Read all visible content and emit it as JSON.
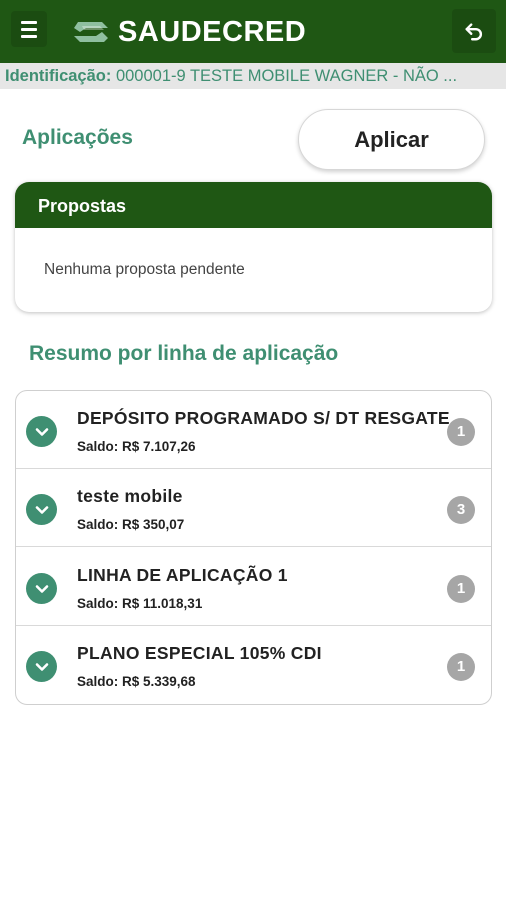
{
  "app": {
    "brand": "SAUDECRED"
  },
  "identification": {
    "label": "Identificação:",
    "value": "000001-9 TESTE MOBILE WAGNER - NÃO ..."
  },
  "applications": {
    "title": "Aplicações",
    "apply_button": "Aplicar"
  },
  "proposals": {
    "header": "Propostas",
    "empty_message": "Nenhuma proposta pendente"
  },
  "summary": {
    "title": "Resumo por linha de aplicação",
    "items": [
      {
        "title": "DEPÓSITO PROGRAMADO S/ DT RESGATE",
        "saldo": "Saldo: R$ 7.107,26",
        "count": "1"
      },
      {
        "title": "teste mobile",
        "saldo": "Saldo: R$ 350,07",
        "count": "3"
      },
      {
        "title": "LINHA DE APLICAÇÃO 1",
        "saldo": "Saldo: R$ 11.018,31",
        "count": "1"
      },
      {
        "title": "PLANO ESPECIAL 105% CDI",
        "saldo": "Saldo: R$ 5.339,68",
        "count": "1"
      }
    ]
  },
  "icons": {
    "menu": "hamburger-menu-icon",
    "back": "undo-arrow-icon",
    "logo": "saudecred-logo-icon",
    "expand": "chevron-down-icon"
  },
  "colors": {
    "primary": "#1f5714",
    "accent": "#3f8f72",
    "badge": "#a6a6a6"
  }
}
